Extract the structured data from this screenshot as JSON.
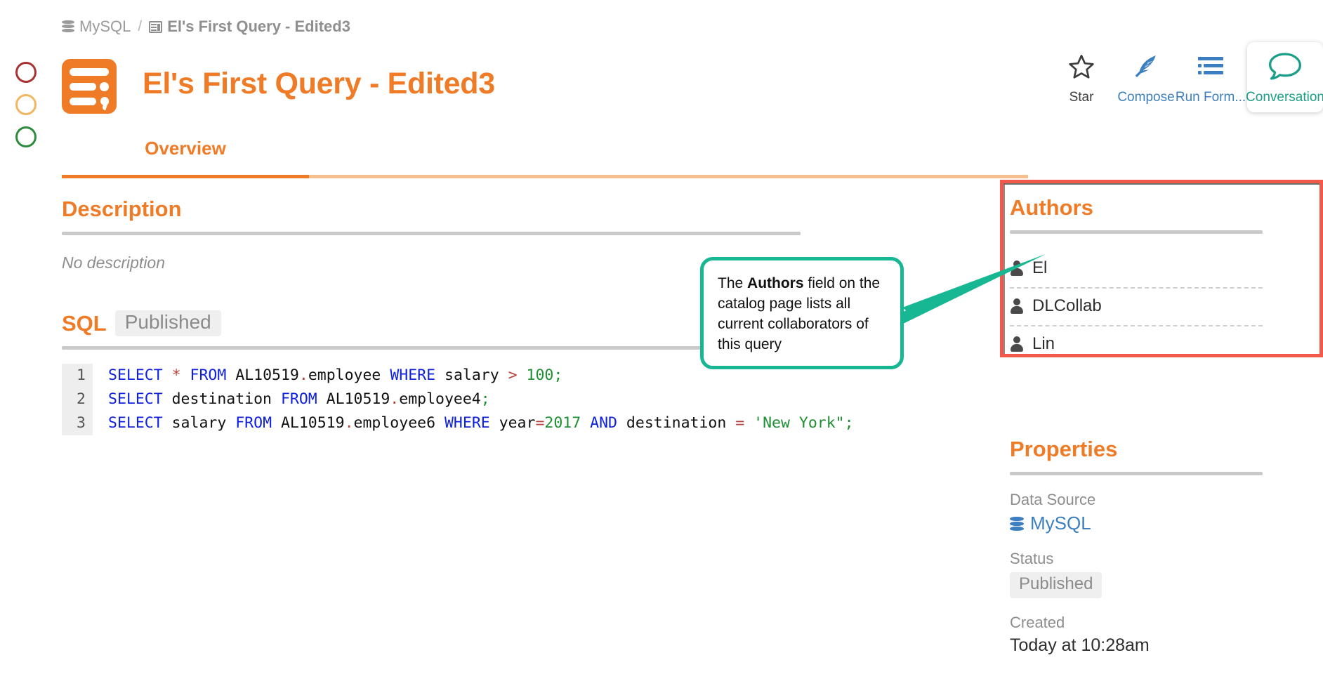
{
  "window": {
    "traffic_lights": [
      {
        "name": "close",
        "color": "#A83232"
      },
      {
        "name": "minimize",
        "color": "#F0B662"
      },
      {
        "name": "zoom",
        "color": "#2E8B3D"
      }
    ]
  },
  "breadcrumb": {
    "items": [
      {
        "icon": "database-icon",
        "label": "MySQL",
        "strong": false
      },
      {
        "icon": "query-icon",
        "label": "El's First Query - Edited3",
        "strong": true
      }
    ],
    "separator": "/"
  },
  "header": {
    "app_icon": "query-app-icon",
    "title": "El's First Query - Edited3",
    "accent_color": "#F07B27"
  },
  "toolbar": {
    "buttons": [
      {
        "name": "star",
        "icon": "star-icon",
        "label": "Star",
        "color": "#3c3c3c",
        "active": false
      },
      {
        "name": "compose",
        "icon": "feather-icon",
        "label": "Compose",
        "color": "#3C7FC0",
        "active": false
      },
      {
        "name": "run-form",
        "icon": "list-icon",
        "label": "Run Form...",
        "color": "#3C7FC0",
        "active": false
      },
      {
        "name": "conversation",
        "icon": "speech-bubble-icon",
        "label": "Conversation",
        "color": "#1B9E87",
        "active": true
      }
    ]
  },
  "tabs": {
    "items": [
      {
        "label": "Overview",
        "active": true
      }
    ]
  },
  "description": {
    "heading": "Description",
    "body": "No description"
  },
  "sql": {
    "heading": "SQL",
    "status_badge": "Published",
    "lines": [
      {
        "number": "1",
        "tokens": [
          {
            "t": "SELECT",
            "c": "kw"
          },
          {
            "t": " ",
            "c": "plain"
          },
          {
            "t": "*",
            "c": "op"
          },
          {
            "t": " ",
            "c": "plain"
          },
          {
            "t": "FROM",
            "c": "kw"
          },
          {
            "t": " AL10519",
            "c": "plain"
          },
          {
            "t": ".",
            "c": "dot"
          },
          {
            "t": "employee ",
            "c": "plain"
          },
          {
            "t": "WHERE",
            "c": "kw"
          },
          {
            "t": " salary ",
            "c": "plain"
          },
          {
            "t": ">",
            "c": "op"
          },
          {
            "t": " ",
            "c": "plain"
          },
          {
            "t": "100",
            "c": "num"
          },
          {
            "t": ";",
            "c": "pun"
          }
        ]
      },
      {
        "number": "2",
        "tokens": [
          {
            "t": "SELECT",
            "c": "kw"
          },
          {
            "t": " destination ",
            "c": "plain"
          },
          {
            "t": "FROM",
            "c": "kw"
          },
          {
            "t": " AL10519",
            "c": "plain"
          },
          {
            "t": ".",
            "c": "dot"
          },
          {
            "t": "employee4",
            "c": "plain"
          },
          {
            "t": ";",
            "c": "pun"
          }
        ]
      },
      {
        "number": "3",
        "tokens": [
          {
            "t": "SELECT",
            "c": "kw"
          },
          {
            "t": " salary ",
            "c": "plain"
          },
          {
            "t": "FROM",
            "c": "kw"
          },
          {
            "t": " AL10519",
            "c": "plain"
          },
          {
            "t": ".",
            "c": "dot"
          },
          {
            "t": "employee6 ",
            "c": "plain"
          },
          {
            "t": "WHERE",
            "c": "kw"
          },
          {
            "t": " year",
            "c": "plain"
          },
          {
            "t": "=",
            "c": "op"
          },
          {
            "t": "2017",
            "c": "num"
          },
          {
            "t": " ",
            "c": "plain"
          },
          {
            "t": "AND",
            "c": "kw"
          },
          {
            "t": " destination ",
            "c": "plain"
          },
          {
            "t": "=",
            "c": "op"
          },
          {
            "t": " ",
            "c": "plain"
          },
          {
            "t": "'New York\"",
            "c": "str"
          },
          {
            "t": ";",
            "c": "pun"
          }
        ]
      }
    ],
    "plain_text": "SELECT * FROM AL10519.employee WHERE salary > 100;\nSELECT destination FROM AL10519.employee4;\nSELECT salary FROM AL10519.employee6 WHERE year=2017 AND destination = 'New York\";"
  },
  "authors": {
    "heading": "Authors",
    "highlight_color": "#F2594B",
    "people": [
      {
        "icon": "user-icon",
        "name": "El"
      },
      {
        "icon": "user-icon",
        "name": "DLCollab"
      },
      {
        "icon": "user-icon",
        "name": "Lin"
      }
    ]
  },
  "properties": {
    "heading": "Properties",
    "rows": [
      {
        "label": "Data Source",
        "value": "MySQL",
        "type": "link",
        "icon": "database-icon"
      },
      {
        "label": "Status",
        "value": "Published",
        "type": "pill"
      },
      {
        "label": "Created",
        "value": "Today at 10:28am",
        "type": "text"
      }
    ]
  },
  "callout": {
    "color": "#17B793",
    "text_before": "The ",
    "text_bold": "Authors",
    "text_after": " field on the catalog page lists all current collaborators of this query"
  }
}
